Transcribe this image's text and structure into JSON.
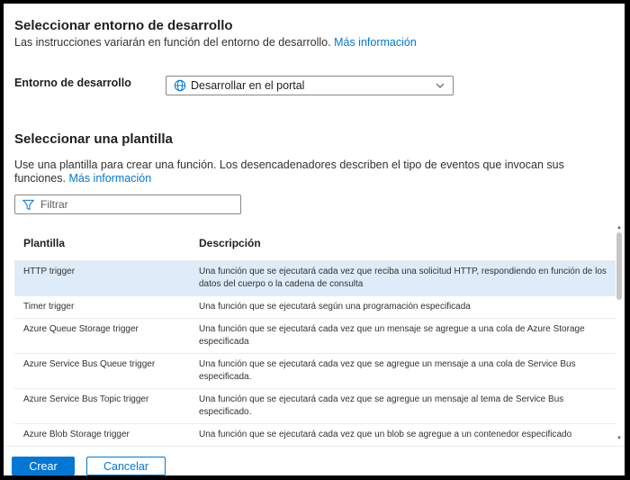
{
  "env_section": {
    "title": "Seleccionar entorno de desarrollo",
    "subtitle": "Las instrucciones variarán en función del entorno de desarrollo.",
    "more_info": "Más información",
    "label": "Entorno de desarrollo",
    "selected": "Desarrollar en el portal"
  },
  "template_section": {
    "title": "Seleccionar una plantilla",
    "description": "Use una plantilla para crear una función. Los desencadenadores describen el tipo de eventos que invocan sus funciones.",
    "more_info": "Más información",
    "filter_placeholder": "Filtrar"
  },
  "table": {
    "headers": [
      "Plantilla",
      "Descripción"
    ],
    "rows": [
      {
        "name": "HTTP trigger",
        "description": "Una función que se ejecutará cada vez que reciba una solicitud HTTP, respondiendo en función de los datos del cuerpo o la cadena de consulta"
      },
      {
        "name": "Timer trigger",
        "description": "Una función que se ejecutará según una programación especificada"
      },
      {
        "name": "Azure Queue Storage trigger",
        "description": "Una función que se ejecutará cada vez que un mensaje se agregue a una cola de Azure Storage especificada"
      },
      {
        "name": "Azure Service Bus Queue trigger",
        "description": "Una función que se ejecutará cada vez que se agregue un mensaje a una cola de Service Bus especificada."
      },
      {
        "name": "Azure Service Bus Topic trigger",
        "description": "Una función que se ejecutará cada vez que se agregue un mensaje al tema de Service Bus especificado."
      },
      {
        "name": "Azure Blob Storage trigger",
        "description": "Una función que se ejecutará cada vez que un blob se agregue a un contenedor especificado"
      }
    ]
  },
  "footer": {
    "create": "Crear",
    "cancel": "Cancelar"
  },
  "colors": {
    "accent": "#0078d4",
    "selected_row": "#deecf9"
  }
}
